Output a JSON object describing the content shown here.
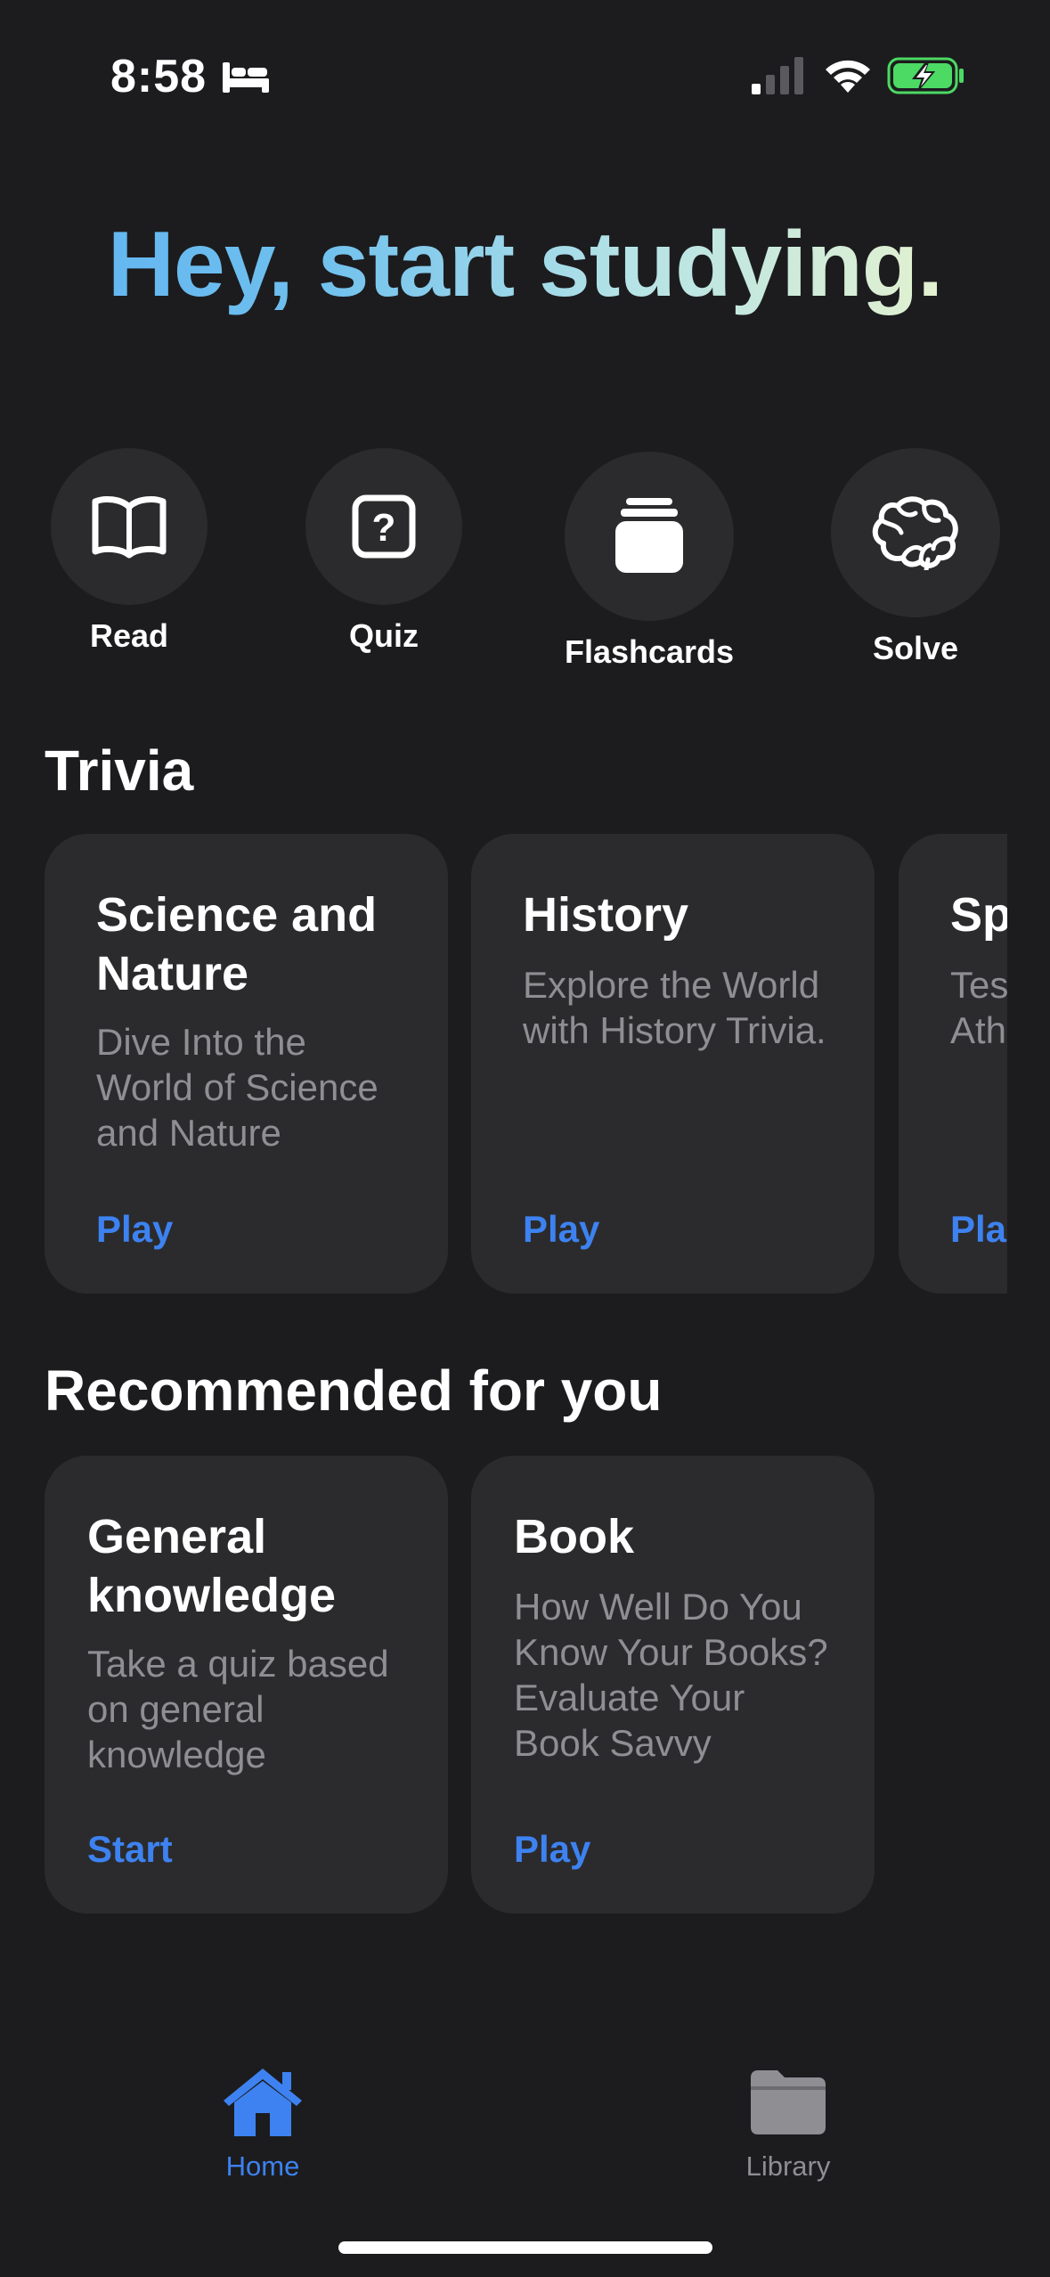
{
  "status_bar": {
    "time": "8:58",
    "icons": [
      "sleep-bed-icon",
      "cellular-signal-icon",
      "wifi-icon",
      "battery-charging-icon"
    ],
    "battery_color": "#4cd964"
  },
  "header": {
    "greeting": "Hey, start studying.",
    "gradient_colors": [
      "#5fb2f1",
      "#b5e3e6",
      "#f3f6c8"
    ]
  },
  "quick_actions": [
    {
      "label": "Read",
      "icon": "open-book-icon"
    },
    {
      "label": "Quiz",
      "icon": "question-square-icon"
    },
    {
      "label": "Flashcards",
      "icon": "card-stack-icon"
    },
    {
      "label": "Solve",
      "icon": "brain-icon"
    }
  ],
  "trivia": {
    "title": "Trivia",
    "cards": [
      {
        "title": "Science and Nature",
        "description": "Dive Into the World of Science and Nature",
        "action": "Play"
      },
      {
        "title": "History",
        "description": "Explore the World with History Trivia.",
        "action": "Play"
      },
      {
        "title": "Sp",
        "description": "Tes Ath",
        "action": "Pla"
      }
    ]
  },
  "recommended": {
    "title": "Recommended for you",
    "cards": [
      {
        "title": "General knowledge",
        "description": "Take a quiz based on general knowledge",
        "action": "Start"
      },
      {
        "title": "Book",
        "description": "How Well Do You Know Your Books? Evaluate Your Book Savvy",
        "action": "Play"
      }
    ]
  },
  "tab_bar": {
    "tabs": [
      {
        "label": "Home",
        "icon": "house-icon",
        "active": true
      },
      {
        "label": "Library",
        "icon": "folder-icon",
        "active": false
      }
    ],
    "accent_color": "#3d82f0",
    "inactive_color": "#8e8e93"
  }
}
